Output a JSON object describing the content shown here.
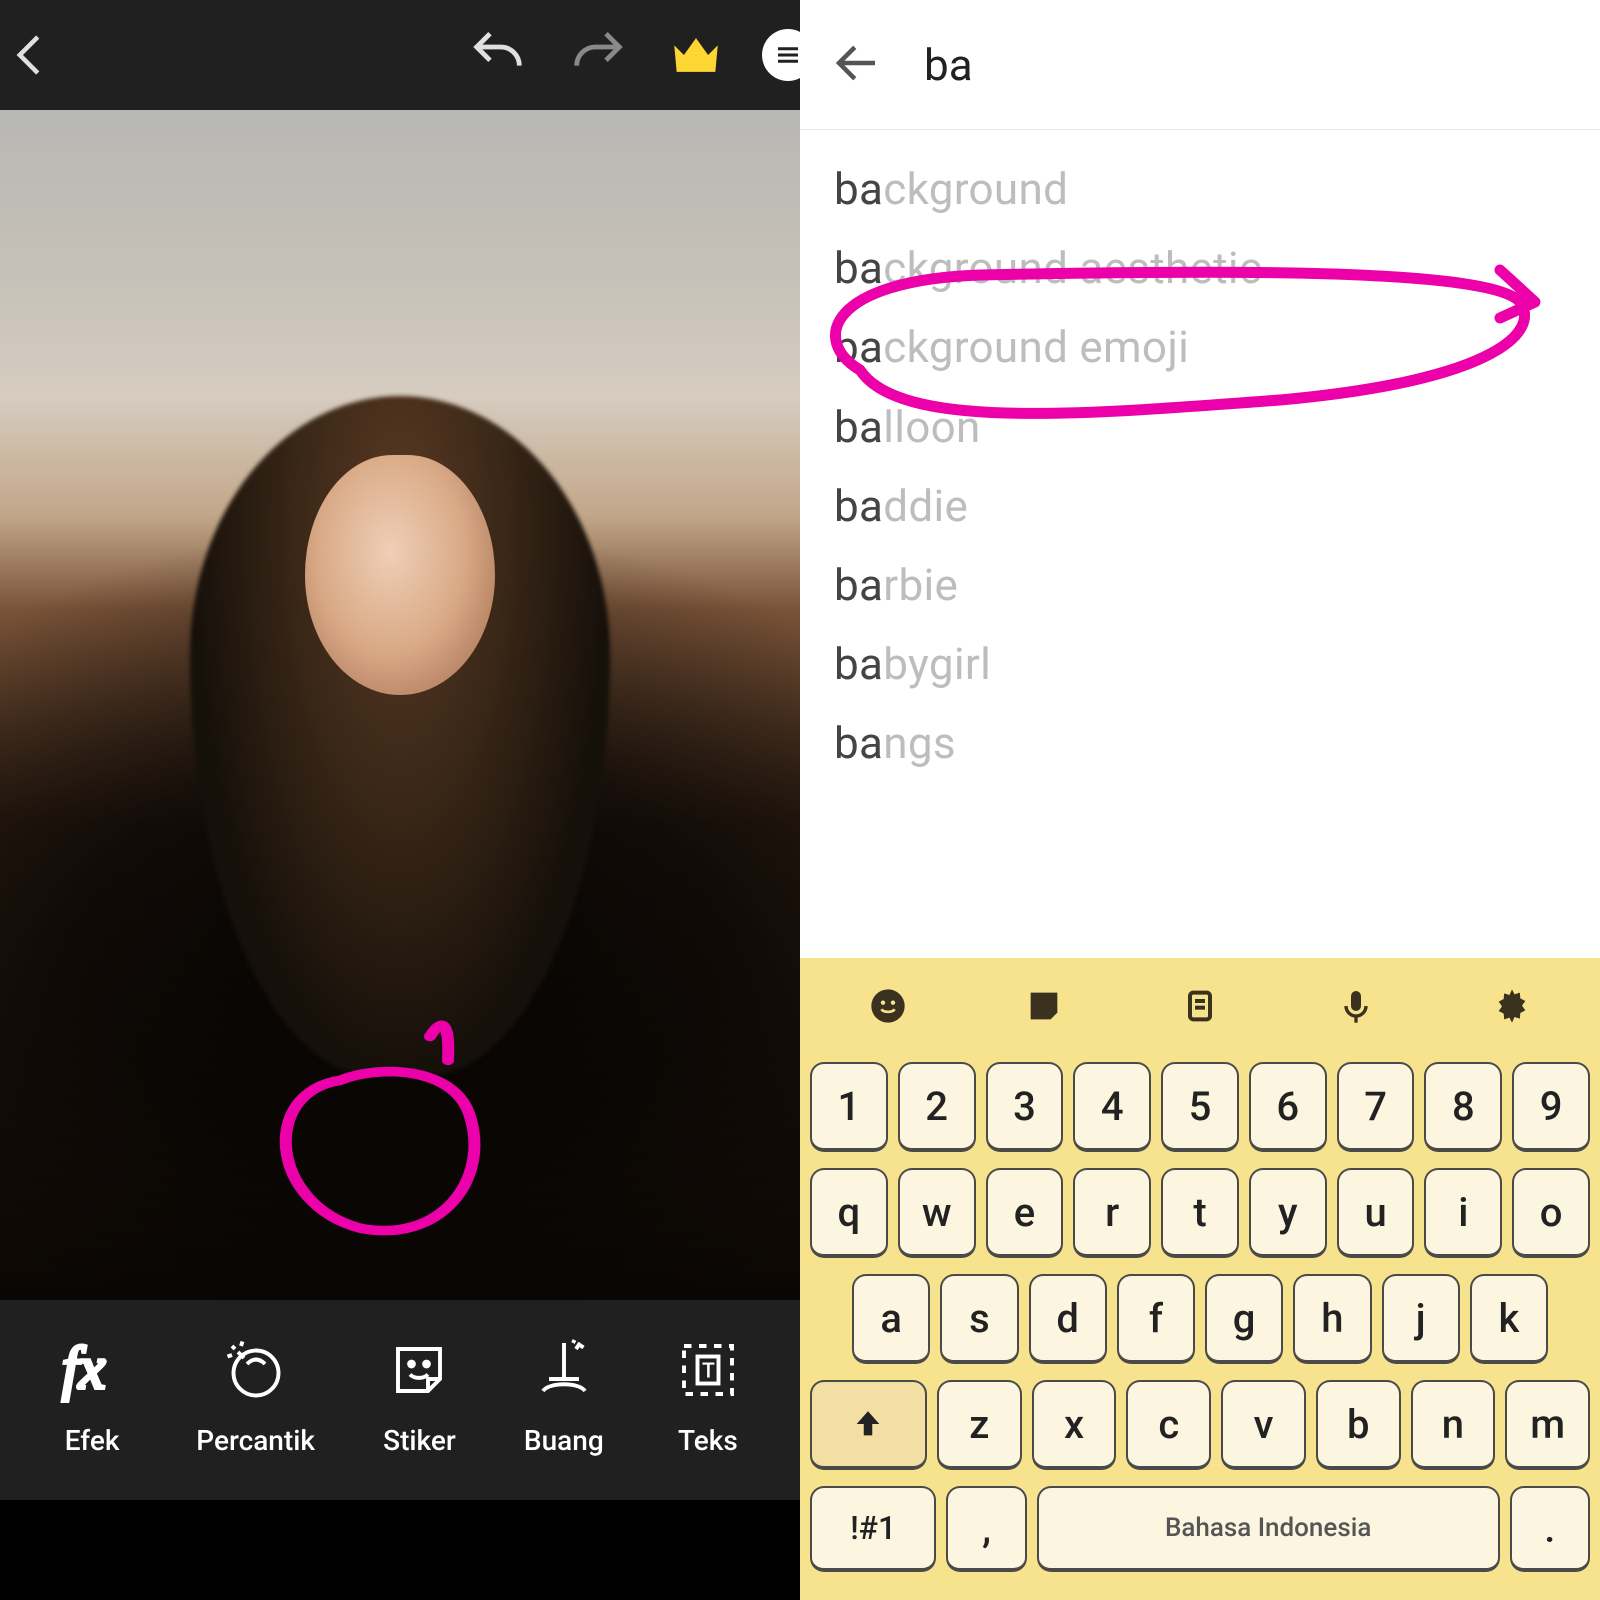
{
  "editor": {
    "topbar": {
      "icons": [
        "back",
        "undo",
        "redo",
        "crown",
        "menu"
      ]
    },
    "tools": [
      {
        "id": "efek",
        "label": "Efek"
      },
      {
        "id": "percantik",
        "label": "Percantik"
      },
      {
        "id": "stiker",
        "label": "Stiker"
      },
      {
        "id": "buang",
        "label": "Buang"
      },
      {
        "id": "teks",
        "label": "Teks"
      }
    ],
    "annotation_target": "stiker"
  },
  "search": {
    "query": "ba",
    "suggestions": [
      "background",
      "background aesthetic",
      "background emoji",
      "balloon",
      "baddie",
      "barbie",
      "babygirl",
      "bangs"
    ],
    "annotation_target_index": 2
  },
  "keyboard": {
    "topbar_icons": [
      "emoji",
      "sticker",
      "clipboard",
      "mic",
      "settings"
    ],
    "rows": {
      "r1": [
        "1",
        "2",
        "3",
        "4",
        "5",
        "6",
        "7",
        "8",
        "9"
      ],
      "r2": [
        "q",
        "w",
        "e",
        "r",
        "t",
        "y",
        "u",
        "i",
        "o"
      ],
      "r3": [
        "a",
        "s",
        "d",
        "f",
        "g",
        "h",
        "j",
        "k"
      ],
      "r4_shift": "⬆",
      "r4": [
        "z",
        "x",
        "c",
        "v",
        "b",
        "n",
        "m"
      ],
      "symbols_label": "!#1",
      "comma": ",",
      "space_label": "Bahasa Indonesia",
      "period": "."
    }
  }
}
